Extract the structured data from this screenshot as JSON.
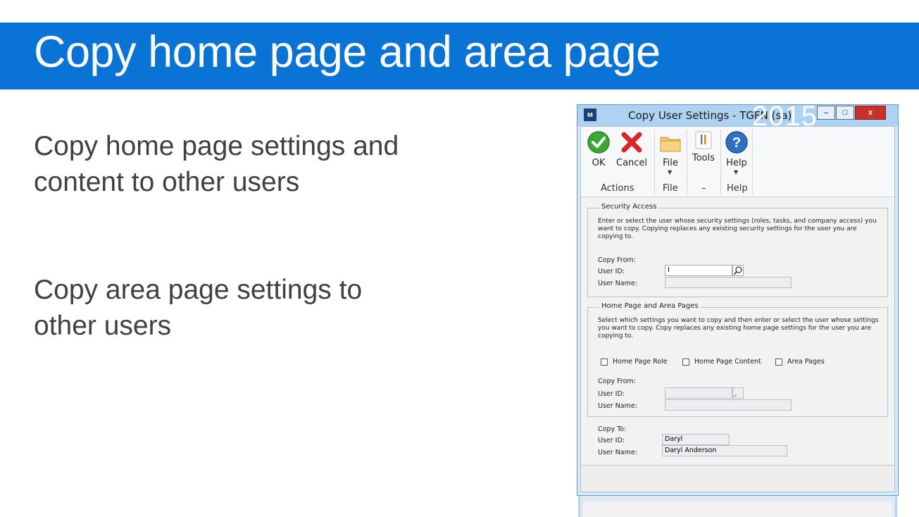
{
  "slide": {
    "title": "Copy home page and area page",
    "bullet1": "Copy home page settings and content to other users",
    "bullet2": "Copy area page settings to other users"
  },
  "window": {
    "title": "Copy User Settings  -  TGFN (sa)",
    "overlay_year": "2015",
    "minimize": "–",
    "maximize": "□",
    "close": "x"
  },
  "ribbon": {
    "ok": "OK",
    "cancel": "Cancel",
    "file": "File",
    "tools": "Tools",
    "help": "Help",
    "groups": {
      "actions": "Actions",
      "file": "File",
      "tools": "–",
      "help": "Help"
    }
  },
  "security_access": {
    "title": "Security Access",
    "description": "Enter or select the user whose security settings (roles, tasks, and company access) you want to copy. Copying replaces any existing security settings for the user you are copying to.",
    "copy_from_label": "Copy From:",
    "user_id_label": "User ID:",
    "user_id_value": "I",
    "user_name_label": "User Name:",
    "user_name_value": ""
  },
  "home_area": {
    "title": "Home Page and Area Pages",
    "description": "Select which settings you want to copy and then enter or select the user whose settings you want to copy. Copy replaces any existing home page settings for the user you are copying to.",
    "checkbox_role": "Home Page Role",
    "checkbox_content": "Home Page Content",
    "checkbox_area": "Area Pages",
    "copy_from_label": "Copy From:",
    "user_id_label": "User ID:",
    "user_id_value": "",
    "user_name_label": "User Name:",
    "user_name_value": ""
  },
  "copy_to": {
    "label": "Copy To:",
    "user_id_label": "User ID:",
    "user_id_value": "Daryl",
    "user_name_label": "User Name:",
    "user_name_value": "Daryl Anderson"
  },
  "colors": {
    "header_blue": "#0a74d6",
    "window_frame": "#aed3f2"
  }
}
